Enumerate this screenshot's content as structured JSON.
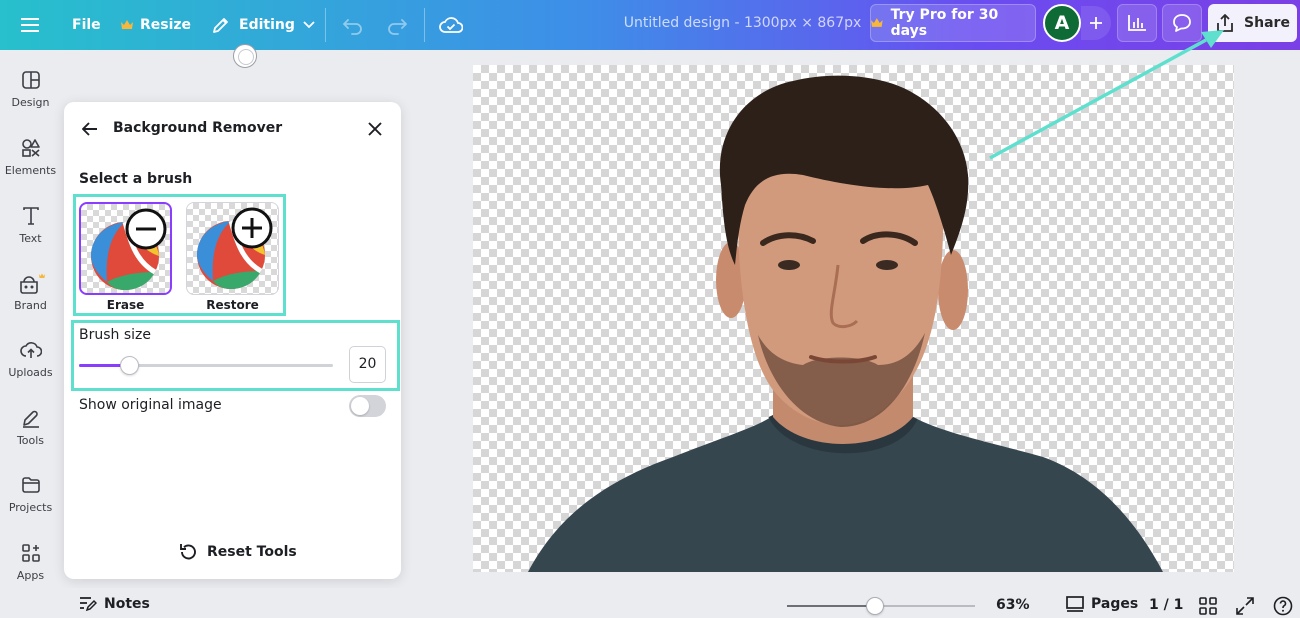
{
  "topbar": {
    "file_label": "File",
    "resize_label": "Resize",
    "editing_label": "Editing",
    "doc_title": "Untitled design - 1300px × 867px",
    "try_pro_label": "Try Pro for 30 days",
    "avatar_initial": "A",
    "share_label": "Share"
  },
  "sidebar": {
    "items": [
      {
        "label": "Design",
        "icon": "design-icon"
      },
      {
        "label": "Elements",
        "icon": "elements-icon"
      },
      {
        "label": "Text",
        "icon": "text-icon"
      },
      {
        "label": "Brand",
        "icon": "brand-icon"
      },
      {
        "label": "Uploads",
        "icon": "uploads-icon"
      },
      {
        "label": "Tools",
        "icon": "tools-icon"
      },
      {
        "label": "Projects",
        "icon": "projects-icon"
      },
      {
        "label": "Apps",
        "icon": "apps-icon"
      }
    ]
  },
  "panel": {
    "title": "Background Remover",
    "brush_heading": "Select a brush",
    "brushes": [
      {
        "label": "Erase",
        "selected": true
      },
      {
        "label": "Restore",
        "selected": false
      }
    ],
    "brush_size_label": "Brush size",
    "brush_size_value": "20",
    "brush_size_fraction": 0.2,
    "show_original_label": "Show original image",
    "show_original_on": false,
    "reset_label": "Reset Tools"
  },
  "bottombar": {
    "notes_label": "Notes",
    "zoom_value": "63%",
    "zoom_fraction": 0.47,
    "pages_label": "Pages",
    "page_count": "1 / 1"
  },
  "colors": {
    "accent": "#8b3dff",
    "highlight": "#5fe0cf",
    "topbar_start": "#27c0cc",
    "topbar_end": "#7b3fe6"
  }
}
